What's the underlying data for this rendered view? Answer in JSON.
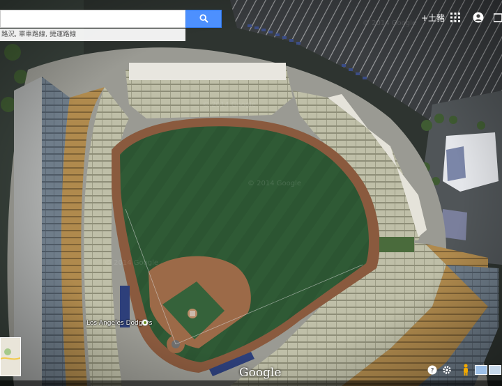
{
  "search": {
    "value": "",
    "button_icon": "search-icon",
    "hint_text": "路況, 單車路線, 捷運路線"
  },
  "toolbar": {
    "sign_in_label": "+土豬",
    "apps_icon": "apps-grid-icon",
    "account_icon": "account-icon"
  },
  "map": {
    "place_label": "Los Angeles Dodgers",
    "watermark": "© 2014 Google",
    "logo": "Google",
    "mode": "satellite"
  },
  "controls": {
    "help_icon": "help-icon",
    "settings_icon": "gear-icon",
    "pegman_icon": "pegman-icon"
  },
  "colors": {
    "search_button": "#4d90fe",
    "field_grass": "#2f5a35",
    "infield_dirt": "#9c6a48"
  }
}
